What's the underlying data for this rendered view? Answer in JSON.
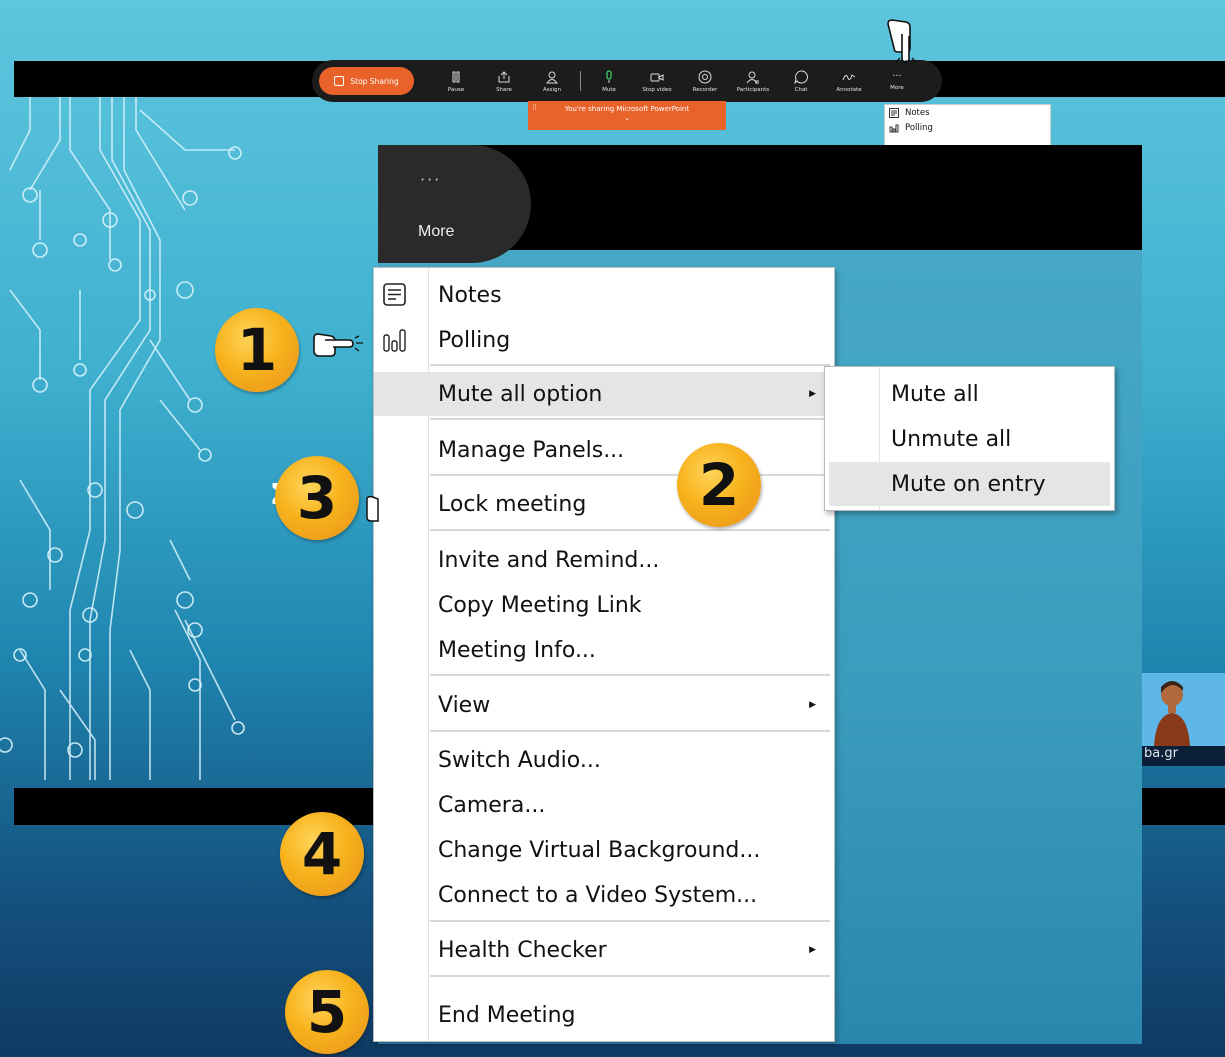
{
  "toolbar": {
    "stop_sharing": "Stop Sharing",
    "buttons": [
      {
        "label": "Pause",
        "icon": "pause-icon"
      },
      {
        "label": "Share",
        "icon": "share-icon"
      },
      {
        "label": "Assign",
        "icon": "assign-icon"
      },
      {
        "label": "Mute",
        "icon": "microphone-icon"
      },
      {
        "label": "Stop video",
        "icon": "video-camera-icon"
      },
      {
        "label": "Recorder",
        "icon": "record-icon"
      },
      {
        "label": "Participants",
        "icon": "participants-icon"
      },
      {
        "label": "Chat",
        "icon": "chat-icon"
      },
      {
        "label": "Annotate",
        "icon": "annotate-icon"
      },
      {
        "label": "More",
        "icon": "more-dots-icon"
      }
    ],
    "accent_color": "#e8622a"
  },
  "share_banner": {
    "text": "You're sharing Microsoft PowerPoint"
  },
  "small_menu": {
    "items": [
      "Notes",
      "Polling"
    ]
  },
  "zoom": {
    "more_label": "More",
    "more_dots": "···"
  },
  "menu": {
    "items": [
      {
        "label": "Notes",
        "icon": "notes-icon"
      },
      {
        "label": "Polling",
        "icon": "polling-icon"
      },
      {
        "label": "Mute all option",
        "submenu": true
      },
      {
        "label": "Manage Panels..."
      },
      {
        "label": "Lock meeting"
      },
      {
        "label": "Invite and Remind..."
      },
      {
        "label": "Copy Meeting Link"
      },
      {
        "label": "Meeting Info..."
      },
      {
        "label": "View",
        "submenu": true
      },
      {
        "label": "Switch Audio..."
      },
      {
        "label": "Camera..."
      },
      {
        "label": "Change Virtual Background..."
      },
      {
        "label": "Connect to a Video System..."
      },
      {
        "label": "Health Checker",
        "submenu": true
      },
      {
        "label": "End Meeting"
      }
    ]
  },
  "submenu": {
    "items": [
      "Mute all",
      "Unmute all",
      "Mute on entry"
    ]
  },
  "badges": [
    "1",
    "2",
    "3",
    "4",
    "5"
  ],
  "background": {
    "partial_text": "Σ",
    "thumb_caption": "ba.gr"
  }
}
